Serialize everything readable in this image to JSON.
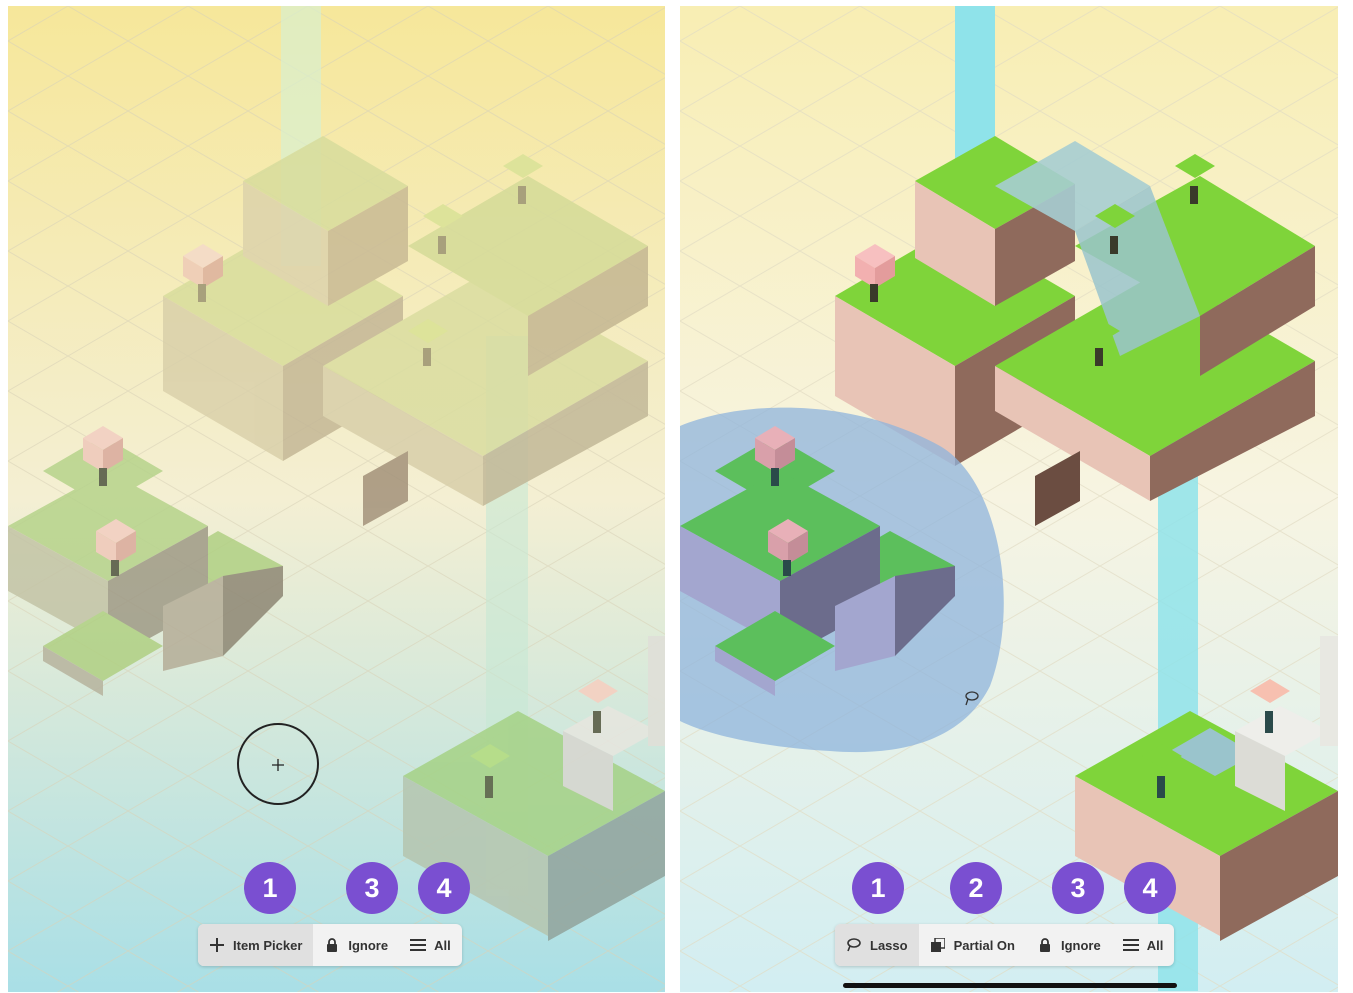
{
  "left_panel": {
    "markers": [
      "1",
      "3",
      "4"
    ],
    "toolbar": [
      {
        "label": "Item Picker",
        "icon": "plus-icon",
        "active": true
      },
      {
        "label": "Ignore",
        "icon": "lock-icon",
        "active": false
      },
      {
        "label": "All",
        "icon": "layers-icon",
        "active": false
      }
    ]
  },
  "right_panel": {
    "markers": [
      "1",
      "2",
      "3",
      "4"
    ],
    "toolbar": [
      {
        "label": "Lasso",
        "icon": "lasso-icon",
        "active": true
      },
      {
        "label": "Partial On",
        "icon": "partial-select-icon",
        "active": false
      },
      {
        "label": "Ignore",
        "icon": "lock-icon",
        "active": false
      },
      {
        "label": "All",
        "icon": "layers-icon",
        "active": false
      }
    ]
  },
  "colors": {
    "marker": "#7a4fd1",
    "grass": "#7fd43a",
    "water": "#8fe3ea",
    "selection": "#8fb4dc"
  }
}
